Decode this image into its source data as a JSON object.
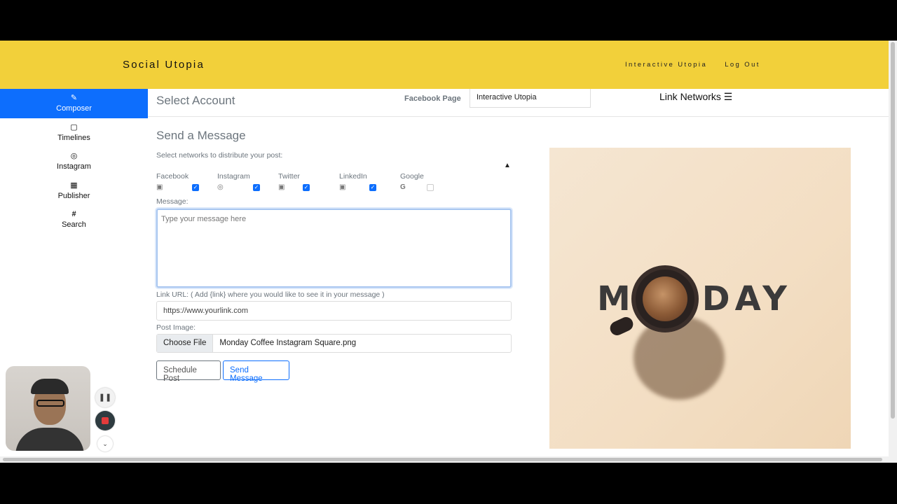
{
  "header": {
    "brand": "Social Utopia",
    "nav": [
      "Interactive Utopia",
      "Log Out"
    ]
  },
  "sidebar": {
    "items": [
      {
        "label": "Composer",
        "icon": "edit-icon",
        "active": true
      },
      {
        "label": "Timelines",
        "icon": "note-icon",
        "active": false
      },
      {
        "label": "Instagram",
        "icon": "instagram-icon",
        "active": false
      },
      {
        "label": "Publisher",
        "icon": "calendar-icon",
        "active": false
      },
      {
        "label": "Search",
        "icon": "hashtag-icon",
        "active": false
      }
    ]
  },
  "account": {
    "title": "Select Account",
    "page_label": "Facebook Page",
    "page_value": "Interactive Utopia",
    "link_networks": "Link Networks ☰"
  },
  "composer": {
    "title": "Send a Message",
    "networks_note": "Select networks to distribute your post:",
    "networks": [
      {
        "name": "Facebook",
        "icon": "facebook-icon",
        "checked": true
      },
      {
        "name": "Instagram",
        "icon": "instagram-icon",
        "checked": true
      },
      {
        "name": "Twitter",
        "icon": "twitter-icon",
        "checked": true
      },
      {
        "name": "LinkedIn",
        "icon": "linkedin-icon",
        "checked": true
      },
      {
        "name": "Google",
        "icon": "google-icon",
        "checked": false
      }
    ],
    "message_label": "Message:",
    "message_placeholder": "Type your message here",
    "link_label": "Link URL: ( Add {link} where you would like to see it in your message )",
    "link_placeholder": "https://www.yourlink.com",
    "image_label": "Post Image:",
    "file_button": "Choose File",
    "file_name": "Monday Coffee Instagram Square.png",
    "schedule_button": "Schedule Post",
    "send_button": "Send Message"
  },
  "preview": {
    "image_text": "MONDAY"
  },
  "recorder": {
    "pause_icon": "pause-icon",
    "record_icon": "stop-record-icon",
    "more_icon": "chevron-down-icon"
  }
}
